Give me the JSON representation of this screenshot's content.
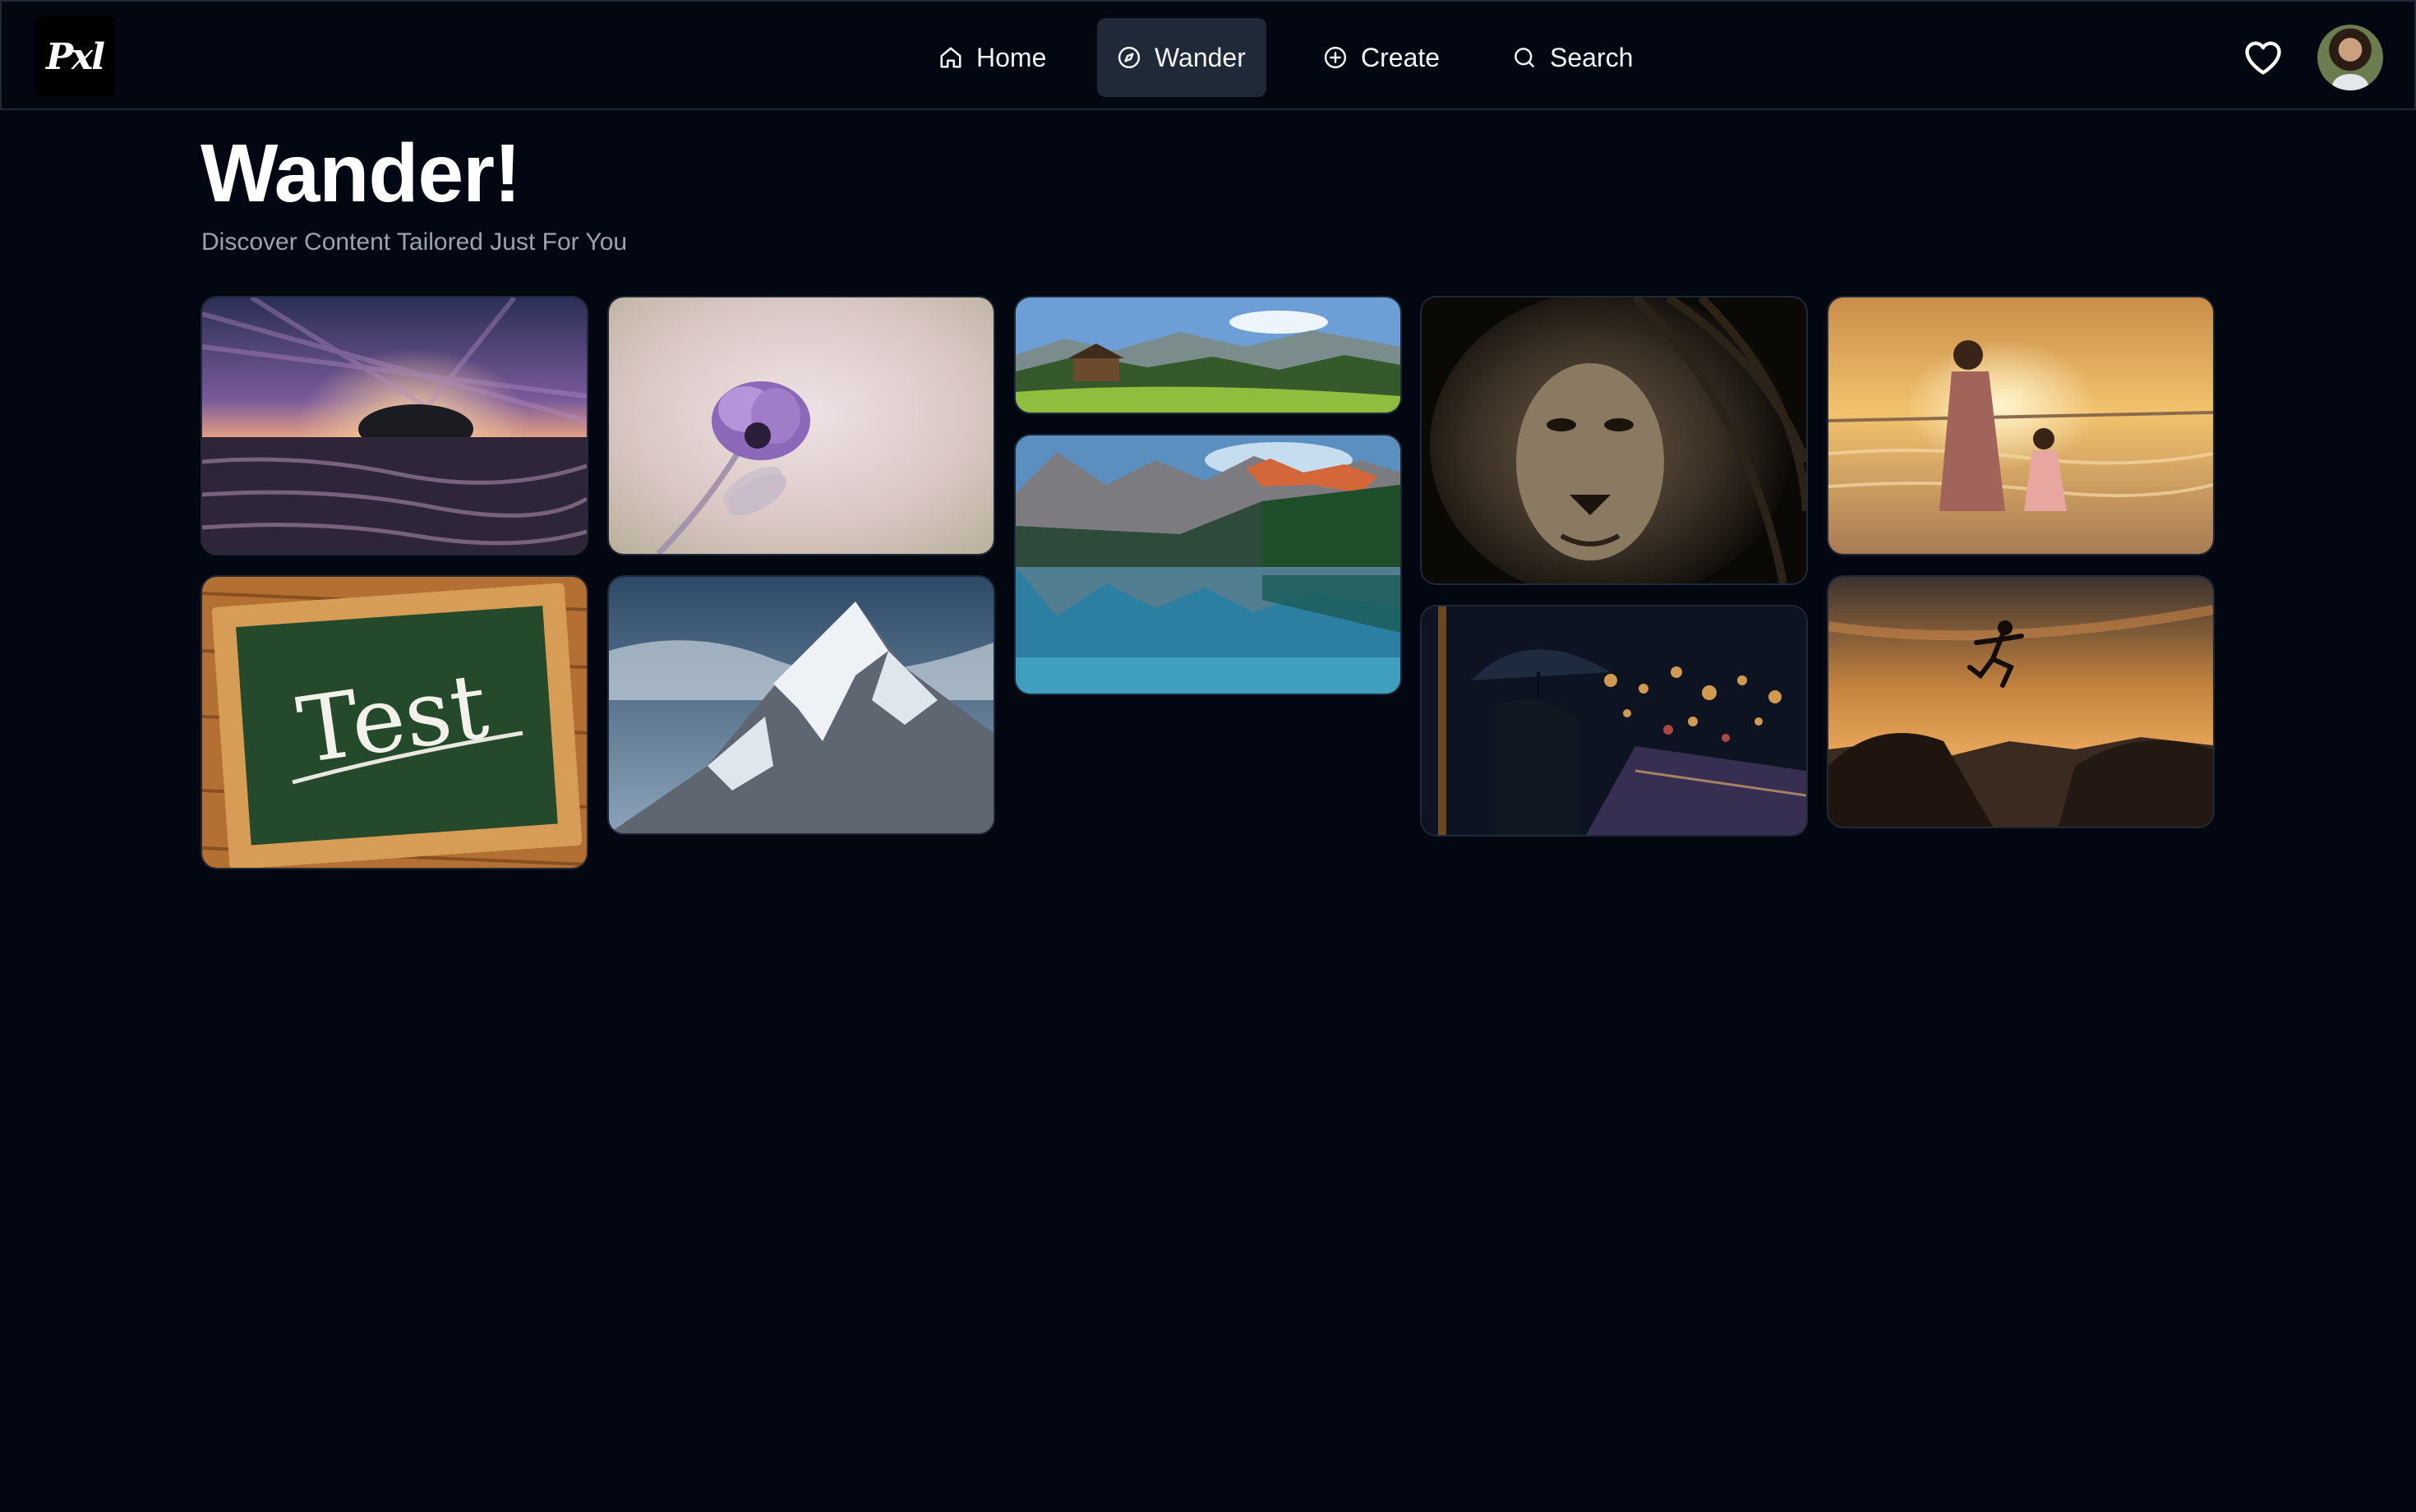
{
  "app": {
    "logo_text": "Pxl"
  },
  "nav": {
    "items": [
      {
        "label": "Home",
        "icon": "home-icon",
        "active": false
      },
      {
        "label": "Wander",
        "icon": "compass-icon",
        "active": true
      },
      {
        "label": "Create",
        "icon": "plus-circle-icon",
        "active": false
      },
      {
        "label": "Search",
        "icon": "search-icon",
        "active": false
      }
    ],
    "favorites_icon": "heart-icon",
    "avatar": "user-avatar"
  },
  "page": {
    "title": "Wander!",
    "subtitle": "Discover Content Tailored Just For You"
  },
  "gallery": {
    "images": [
      {
        "subject": "sunset-tree-tideflat"
      },
      {
        "subject": "purple-flower"
      },
      {
        "subject": "mountain-cabin-meadow"
      },
      {
        "subject": "lion-portrait"
      },
      {
        "subject": "mother-child-beach-sunset"
      },
      {
        "subject": "chalkboard-test"
      },
      {
        "subject": "snowy-mountain-peak"
      },
      {
        "subject": "mountain-lake-reflection"
      },
      {
        "subject": "umbrella-city-night"
      },
      {
        "subject": "jumping-silhouette-sunset"
      }
    ],
    "chalkboard_text": "Test"
  },
  "colors": {
    "background": "#030712",
    "nav_active": "#1f2937",
    "subtitle": "#9ca3af"
  }
}
